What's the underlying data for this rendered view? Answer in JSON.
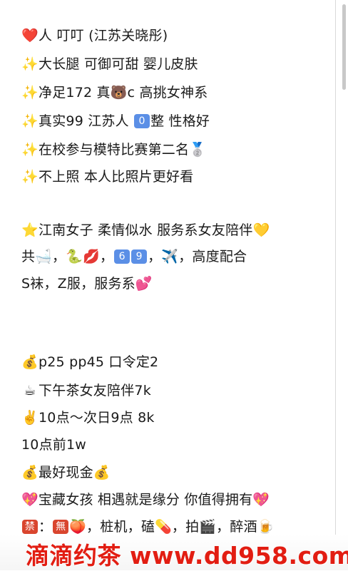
{
  "lines": [
    {
      "icon": "❤️",
      "text": "人   叮叮  (江苏关晓彤)"
    },
    {
      "icon": "✨",
      "text": "大长腿 可御可甜 婴儿皮肤"
    },
    {
      "icon": "✨",
      "text": "净足172   真🐻c   高挑女神系"
    },
    {
      "icon": "✨",
      "text": "真实99  江苏人 ",
      "badge": "0",
      "text2": "整  性格好"
    },
    {
      "icon": "✨",
      "text": "在校参与模特比赛第二名🥈"
    },
    {
      "icon": "✨",
      "text": "不上照 本人比照片更好看"
    },
    {
      "icon": "⭐",
      "text": "江南女子 柔情似水 服务系女友陪伴💛"
    },
    {
      "icon": "",
      "text": " 共🛁，🐍💋，",
      "badge": "6",
      "badge2": "9",
      "text2": "，✈️，高度配合"
    },
    {
      "icon": "",
      "text": " S袜，Z服，服务系💕"
    },
    {
      "icon": "💰",
      "text": "p25  pp45     口令定2"
    },
    {
      "icon": "☕",
      "text": "下午茶女友陪伴7k"
    },
    {
      "icon": "✌️",
      "text": "10点～次日9点  8k"
    },
    {
      "icon": "",
      "text": "   10点前1w"
    },
    {
      "icon": "💰",
      "text": "最好现金💰"
    },
    {
      "icon": "",
      "text": " 💖宝藏女孩 相遇就是缘分 你值得拥有💖"
    },
    {
      "icon": "",
      "ban": "禁",
      "text": "：",
      "ban2": "無",
      "text2": "🍑，桩机，磕💊，拍🎬，醉酒🍺"
    }
  ],
  "watermark": "滴滴约茶  www.dd958.com"
}
